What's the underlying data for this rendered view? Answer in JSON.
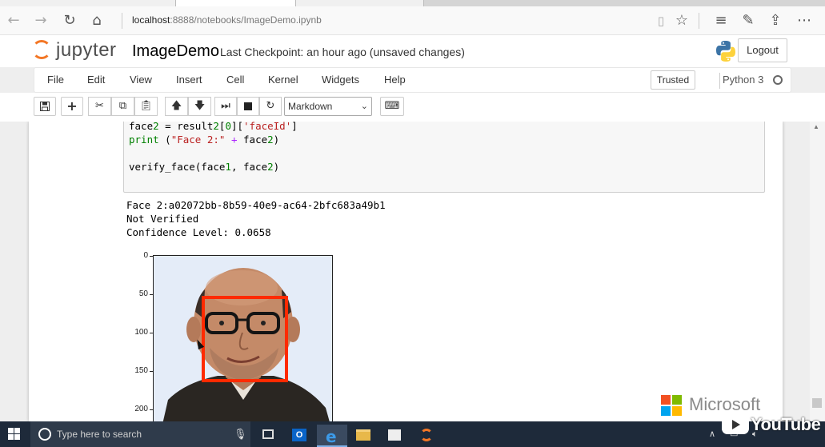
{
  "browser": {
    "url_host": "localhost",
    "url_path": ":8888/notebooks/ImageDemo.ipynb"
  },
  "header": {
    "logo_text": "jupyter",
    "notebook_name": "ImageDemo",
    "checkpoint": "Last Checkpoint: an hour ago (unsaved changes)",
    "logout_label": "Logout"
  },
  "menu": {
    "items": [
      "File",
      "Edit",
      "View",
      "Insert",
      "Cell",
      "Kernel",
      "Widgets",
      "Help"
    ],
    "trusted_label": "Trusted",
    "kernel_name": "Python 3"
  },
  "toolbar": {
    "cell_type": "Markdown"
  },
  "cell": {
    "code_lines": [
      "face2 = result2[0]['faceId']",
      "print (\"Face 2:\" + face2)",
      "",
      "verify_face(face1, face2)"
    ],
    "output_lines": [
      "Face 2:a02072bb-8b59-40e9-ac64-2bfc683a49b1",
      "Not Verified",
      "Confidence Level: 0.0658"
    ]
  },
  "figure": {
    "y_ticks": [
      "0",
      "50",
      "100",
      "150",
      "200"
    ],
    "face_box_color": "#ff2a00"
  },
  "watermarks": {
    "microsoft": "Microsoft",
    "youtube": "YouTube"
  },
  "taskbar": {
    "search_placeholder": "Type here to search"
  },
  "colors": {
    "jupyter_orange": "#f37726",
    "taskbar_bg": "#1e2a3a"
  }
}
